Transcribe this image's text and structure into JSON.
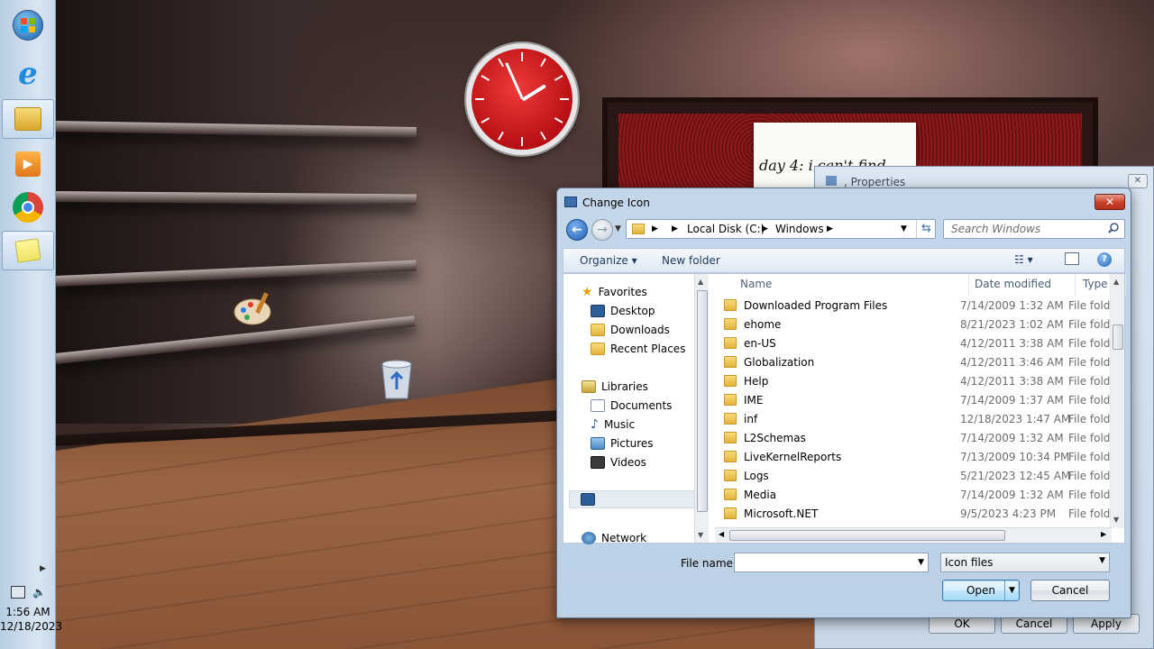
{
  "desktop": {
    "note_text": "day 4: i can't find",
    "icons": [
      "paint-icon",
      "recycle-bin-icon"
    ]
  },
  "taskbar": {
    "buttons": [
      {
        "name": "start-button",
        "icon": "windows-orb-icon"
      },
      {
        "name": "internet-explorer",
        "icon": "ie-icon"
      },
      {
        "name": "windows-explorer",
        "icon": "folder-library-icon",
        "active": true
      },
      {
        "name": "media-player",
        "icon": "media-player-icon"
      },
      {
        "name": "chrome",
        "icon": "chrome-icon"
      },
      {
        "name": "sticky-notes",
        "icon": "sticky-notes-icon",
        "active": true
      }
    ],
    "time": "1:56 AM",
    "date": "12/18/2023"
  },
  "properties_dialog": {
    "title": "Properties",
    "ok": "OK",
    "cancel": "Cancel",
    "apply": "Apply"
  },
  "change_icon_dialog": {
    "title": "Change Icon",
    "breadcrumb": [
      "Local Disk (C:)",
      "Windows"
    ],
    "search_placeholder": "Search Windows",
    "organize": "Organize ▾",
    "new_folder": "New folder",
    "nav": {
      "favorites": "Favorites",
      "desktop": "Desktop",
      "downloads": "Downloads",
      "recent": "Recent Places",
      "libraries": "Libraries",
      "documents": "Documents",
      "music": "Music",
      "pictures": "Pictures",
      "videos": "Videos",
      "network": "Network"
    },
    "columns": {
      "name": "Name",
      "date": "Date modified",
      "type": "Type"
    },
    "files": [
      {
        "name": "Downloaded Program Files",
        "date": "7/14/2009 1:32 AM",
        "type": "File folder"
      },
      {
        "name": "ehome",
        "date": "8/21/2023 1:02 AM",
        "type": "File folder"
      },
      {
        "name": "en-US",
        "date": "4/12/2011 3:38 AM",
        "type": "File folder"
      },
      {
        "name": "Globalization",
        "date": "4/12/2011 3:46 AM",
        "type": "File folder"
      },
      {
        "name": "Help",
        "date": "4/12/2011 3:38 AM",
        "type": "File folder"
      },
      {
        "name": "IME",
        "date": "7/14/2009 1:37 AM",
        "type": "File folder"
      },
      {
        "name": "inf",
        "date": "12/18/2023 1:47 AM",
        "type": "File folder"
      },
      {
        "name": "L2Schemas",
        "date": "7/14/2009 1:32 AM",
        "type": "File folder"
      },
      {
        "name": "LiveKernelReports",
        "date": "7/13/2009 10:34 PM",
        "type": "File folder"
      },
      {
        "name": "Logs",
        "date": "5/21/2023 12:45 AM",
        "type": "File folder"
      },
      {
        "name": "Media",
        "date": "7/14/2009 1:32 AM",
        "type": "File folder"
      },
      {
        "name": "Microsoft.NET",
        "date": "9/5/2023 4:23 PM",
        "type": "File folder"
      }
    ],
    "file_name_label": "File name:",
    "file_name_value": "",
    "file_type": "Icon files",
    "open": "Open",
    "cancel": "Cancel"
  }
}
